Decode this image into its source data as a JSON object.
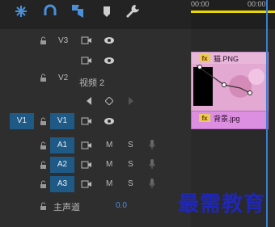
{
  "toolbar": {
    "tools": [
      {
        "name": "snap-icon",
        "active": true
      },
      {
        "name": "link-icon",
        "active": true
      },
      {
        "name": "marker-flag-icon",
        "active": true
      },
      {
        "name": "add-marker-icon",
        "active": false
      },
      {
        "name": "wrench-icon",
        "active": false
      }
    ]
  },
  "ruler": {
    "ticks": [
      "00:00",
      "00:00"
    ],
    "accent": "#e8d800"
  },
  "video_tracks": [
    {
      "id": "V3"
    },
    {
      "id": ""
    },
    {
      "id": "V2",
      "name": "视频 2"
    },
    {
      "id": "V1",
      "source": "V1"
    }
  ],
  "audio_tracks": [
    {
      "id": "A1",
      "m": "M",
      "s": "S"
    },
    {
      "id": "A2",
      "m": "M",
      "s": "S"
    },
    {
      "id": "A3",
      "m": "M",
      "s": "S"
    }
  ],
  "master": {
    "label": "主声道",
    "value": "0.0"
  },
  "clips": {
    "top_name": "猫.PNG",
    "bottom_name": "背景.jpg",
    "fx": "fx"
  },
  "watermark": "最需教育",
  "colors": {
    "patch": "#1f5a86",
    "playhead": "#3a7fd0",
    "clip_pink": "#e7b6d9",
    "clip_bg": "#dc8ee0"
  }
}
